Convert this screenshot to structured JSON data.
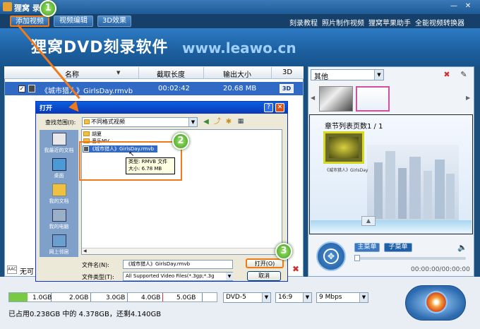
{
  "app": {
    "title": "狸窝DVD刻录软件",
    "title_visible": "狸窝      录软件"
  },
  "toolbar": {
    "add_video": "添加视频",
    "edit_video": "视频编辑",
    "effect_3d": "3D效果",
    "links": [
      "刻录教程",
      "照片制作视频",
      "狸窝苹果助手",
      "全能视频转换器"
    ]
  },
  "banner": {
    "title": "狸窝DVD刻录软件",
    "url": "www.leawo.cn"
  },
  "file_list": {
    "columns": [
      "名称",
      "截取长度",
      "输出大小",
      "3D"
    ],
    "rows": [
      {
        "name": "《城市猎人》GirlsDay.rmvb",
        "length": "00:02:42",
        "size": "20.68 MB",
        "threed": "3D"
      }
    ],
    "aac_label": "无可"
  },
  "right_panel": {
    "menu_type": "其他",
    "page_label": "章节列表页数1 / 1",
    "thumb_caption": "《城市猎人》GirlsDay",
    "main_menu": "主菜单",
    "sub_menu": "子菜单",
    "timecode": "00:00:00/00:00:00"
  },
  "bottom": {
    "capacity_ticks": [
      "1.0GB",
      "2.0GB",
      "3.0GB",
      "4.0GB",
      "5.0GB"
    ],
    "capacity_used_fraction": 0.05,
    "usage_text": "已占用0.238GB 中的 4.378GB，还剩4.140GB",
    "disc_type": "DVD-5",
    "aspect": "16:9",
    "bitrate": "9 Mbps"
  },
  "dialog": {
    "title": "打开",
    "lookin_label": "查找范围(I):",
    "lookin_value": "不同格式视频",
    "places": [
      "我最近的文档",
      "桌面",
      "我的文档",
      "我的电脑",
      "网上邻居"
    ],
    "folders": [
      "胡夏",
      "音乐MV"
    ],
    "selected_file": "《城市猎人》GirlsDay.rmvb",
    "tooltip_type": "类型: RMVB 文件",
    "tooltip_size": "大小: 6.78 MB",
    "filename_label": "文件名(N):",
    "filename_value": "《城市猎人》GirlsDay.rmvb",
    "filetype_label": "文件类型(T):",
    "filetype_value": "All Supported Video Files(*.3gp;*.3g",
    "open_button": "打开(O)",
    "cancel_button": "取消"
  },
  "annotations": [
    "1",
    "2",
    "3"
  ],
  "colors": {
    "accent": "#f07a1a",
    "selection": "#316ac5",
    "badge": "#4fae27"
  }
}
